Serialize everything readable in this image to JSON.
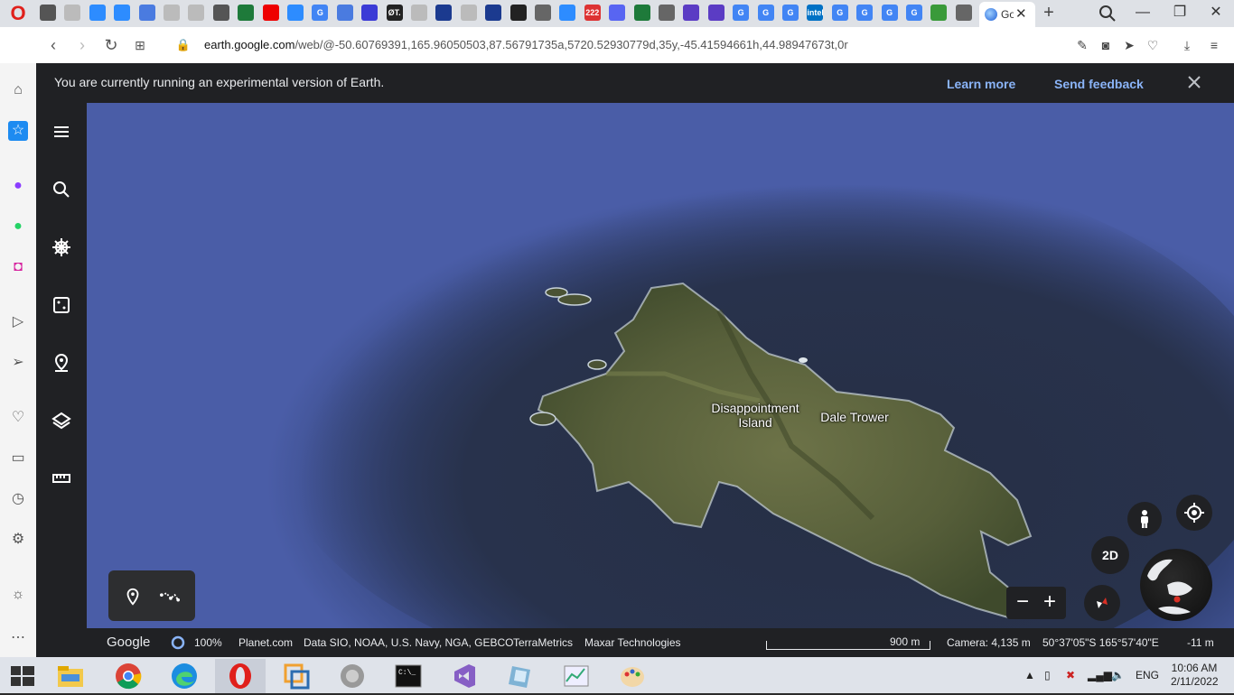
{
  "browser": {
    "active_tab_title": "Go",
    "url_domain": "earth.google.com",
    "url_path": "/web/@-50.60769391,165.96050503,87.56791735a,5720.52930779d,35y,-45.41594661h,44.98947673t,0r",
    "tab_favicons": [
      {
        "name": "tab-icon-1",
        "char": "",
        "color": "#555"
      },
      {
        "name": "tab-icon-2",
        "char": "",
        "color": "#bbb"
      },
      {
        "name": "tab-icon-3",
        "char": "",
        "color": "#2d8cff"
      },
      {
        "name": "tab-icon-4",
        "char": "",
        "color": "#2d8cff"
      },
      {
        "name": "tab-icon-5",
        "char": "",
        "color": "#4a7be0"
      },
      {
        "name": "tab-icon-6",
        "char": "",
        "color": "#bbb"
      },
      {
        "name": "tab-icon-7",
        "char": "",
        "color": "#bbb"
      },
      {
        "name": "tab-icon-8",
        "char": "",
        "color": "#555"
      },
      {
        "name": "tab-icon-9",
        "char": "",
        "color": "#1e7a3a"
      },
      {
        "name": "tab-icon-10",
        "char": "",
        "color": "#e00"
      },
      {
        "name": "tab-icon-11",
        "char": "",
        "color": "#2d8cff"
      },
      {
        "name": "tab-icon-12",
        "char": "G",
        "color": "#4285f4"
      },
      {
        "name": "tab-icon-13",
        "char": "",
        "color": "#4a7be0"
      },
      {
        "name": "tab-icon-14",
        "char": "",
        "color": "#3b3bd6"
      },
      {
        "name": "tab-icon-15",
        "char": "ØT.",
        "color": "#222"
      },
      {
        "name": "tab-icon-16",
        "char": "",
        "color": "#bbb"
      },
      {
        "name": "tab-icon-17",
        "char": "",
        "color": "#1b3a8f"
      },
      {
        "name": "tab-icon-18",
        "char": "",
        "color": "#bbb"
      },
      {
        "name": "tab-icon-19",
        "char": "",
        "color": "#1b3a8f"
      },
      {
        "name": "tab-icon-20",
        "char": "",
        "color": "#222"
      },
      {
        "name": "tab-icon-21",
        "char": "",
        "color": "#666"
      },
      {
        "name": "tab-icon-22",
        "char": "",
        "color": "#2d8cff"
      },
      {
        "name": "tab-icon-23",
        "char": "222",
        "color": "#d33"
      },
      {
        "name": "tab-icon-24",
        "char": "",
        "color": "#5865f2"
      },
      {
        "name": "tab-icon-25",
        "char": "",
        "color": "#1e7a3a"
      },
      {
        "name": "tab-icon-26",
        "char": "",
        "color": "#666"
      },
      {
        "name": "tab-icon-27",
        "char": "",
        "color": "#5b3cc4"
      },
      {
        "name": "tab-icon-28",
        "char": "",
        "color": "#5b3cc4"
      },
      {
        "name": "tab-icon-29",
        "char": "G",
        "color": "#4285f4"
      },
      {
        "name": "tab-icon-30",
        "char": "G",
        "color": "#4285f4"
      },
      {
        "name": "tab-icon-31",
        "char": "G",
        "color": "#4285f4"
      },
      {
        "name": "tab-icon-32",
        "char": "intel",
        "color": "#0071c5"
      },
      {
        "name": "tab-icon-33",
        "char": "G",
        "color": "#4285f4"
      },
      {
        "name": "tab-icon-34",
        "char": "G",
        "color": "#4285f4"
      },
      {
        "name": "tab-icon-35",
        "char": "G",
        "color": "#4285f4"
      },
      {
        "name": "tab-icon-36",
        "char": "G",
        "color": "#4285f4"
      },
      {
        "name": "tab-icon-37",
        "char": "",
        "color": "#3a9a3a"
      },
      {
        "name": "tab-icon-38",
        "char": "",
        "color": "#666"
      }
    ]
  },
  "banner": {
    "text": "You are currently running an experimental version of Earth.",
    "learn_more": "Learn more",
    "send_feedback": "Send feedback"
  },
  "map": {
    "labels": [
      {
        "name": "label-disappointment-island",
        "text": "Disappointment\nIsland"
      },
      {
        "name": "label-dale-trower",
        "text": "Dale Trower"
      }
    ],
    "view_mode_label": "2D"
  },
  "status_bar": {
    "brand": "Google",
    "load_percent": "100%",
    "attribution": [
      "Planet.com",
      "Data SIO, NOAA, U.S. Navy, NGA, GEBCO",
      "TerraMetrics",
      "Maxar Technologies"
    ],
    "scale": "900 m",
    "camera": "Camera: 4,135 m",
    "coordinates": "50°37'05\"S 165°57'40\"E",
    "elevation": "-11 m"
  },
  "taskbar": {
    "language": "ENG",
    "time": "10:06 AM",
    "date": "2/11/2022"
  },
  "colors": {
    "accent_link": "#8ab4f8",
    "panel_dark": "#202124",
    "opera_red": "#e0201b"
  }
}
